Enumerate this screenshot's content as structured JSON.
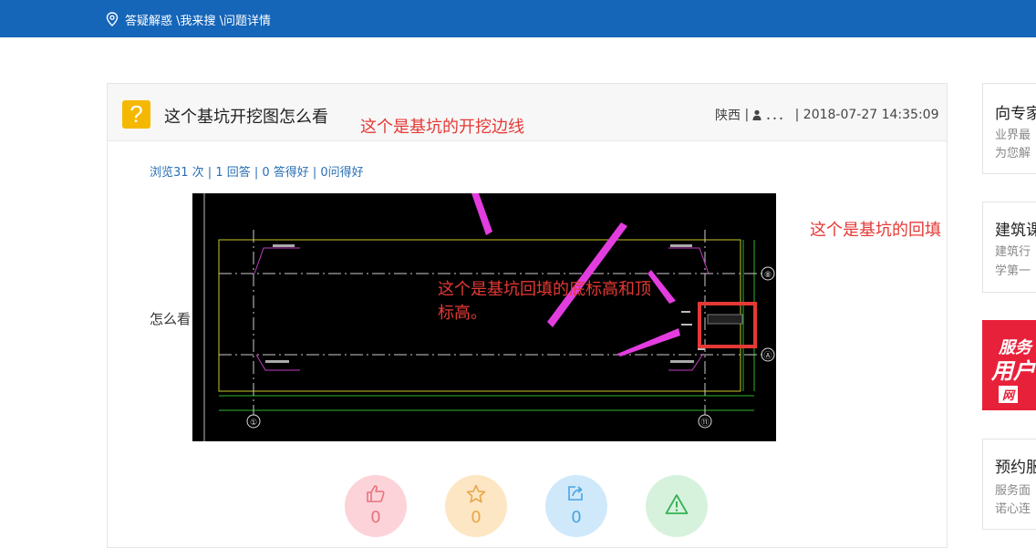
{
  "breadcrumb": {
    "text": "答疑解惑 \\我来搜 \\问题详情"
  },
  "question": {
    "title": "这个基坑开挖图怎么看",
    "location": "陕西",
    "user": "．．．",
    "datetime": "2018-07-27 14:35:09",
    "stats": "浏览31 次 | 1 回答 | 0 答得好 | 0问得好",
    "body": "怎么看"
  },
  "cad": {
    "annotations": [
      "这个是基坑的开挖边线",
      "这个是基坑的回填",
      "这个是基坑回填的底标高和顶标高。"
    ],
    "axis_labels": [
      "⑧",
      "Ⓐ",
      "①",
      "⑪"
    ]
  },
  "actions": [
    {
      "name": "like",
      "count": "0",
      "bg": "#fbd3d8",
      "color": "#e8737f"
    },
    {
      "name": "favorite",
      "count": "0",
      "bg": "#fde6c3",
      "color": "#e9a64a"
    },
    {
      "name": "share",
      "count": "0",
      "bg": "#cfe9fb",
      "color": "#4aa3df"
    },
    {
      "name": "report",
      "count": "",
      "bg": "#d6f2dc",
      "color": "#36b155"
    }
  ],
  "sidebar": {
    "card1": {
      "title": "向专家",
      "desc1": "业界最",
      "desc2": "为您解"
    },
    "card2": {
      "title": "建筑课",
      "desc1": "建筑行",
      "desc2": "学第一"
    },
    "ad": {
      "line1": "服务",
      "line2": "用户",
      "line3": "网"
    },
    "card3": {
      "title": "预约服",
      "desc1": "服务面",
      "desc2": "诺心连"
    }
  }
}
